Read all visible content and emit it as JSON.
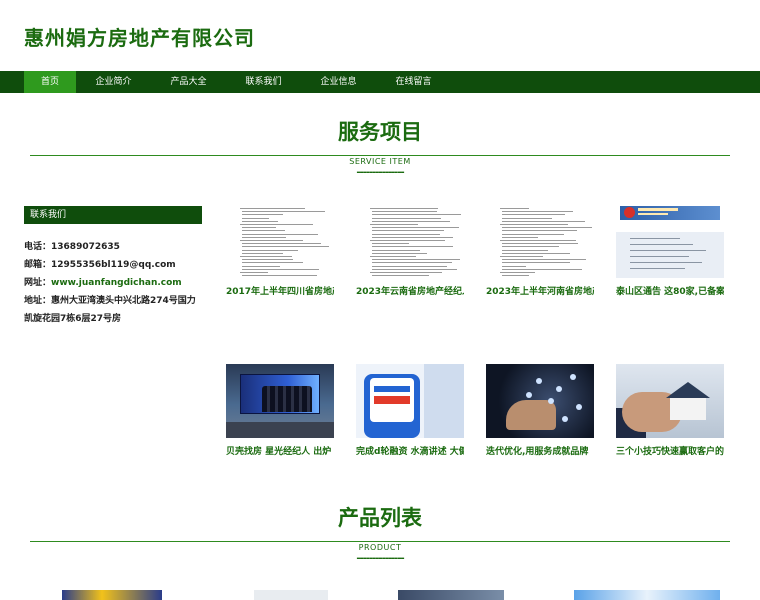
{
  "site": {
    "title": "惠州娟方房地产有限公司"
  },
  "nav": {
    "items": [
      {
        "label": "首页"
      },
      {
        "label": "企业简介"
      },
      {
        "label": "产品大全"
      },
      {
        "label": "联系我们"
      },
      {
        "label": "企业信息"
      },
      {
        "label": "在线留言"
      }
    ]
  },
  "services": {
    "title": "服务项目",
    "subtitle": "SERVICE ITEM",
    "dashes": "---------------"
  },
  "contact": {
    "heading": "联系我们",
    "phone_label": "电话：",
    "phone": "13689072635",
    "email_label": "邮箱：",
    "email": "12955356bl119@qq.com",
    "site_label": "网址：",
    "site": "www.juanfangdichan.com",
    "address_label": "地址：",
    "address": "惠州大亚湾澳头中兴北路274号国力凯旋花园7栋6层27号房"
  },
  "cards": [
    {
      "caption": "2017年上半年四川省房地产"
    },
    {
      "caption": "2023年云南省房地产经纪人"
    },
    {
      "caption": "2023年上半年河南省房地产"
    },
    {
      "caption": "泰山区通告 这80家,已备案"
    },
    {
      "caption": "贝壳找房 星光经纪人 出炉 诠"
    },
    {
      "caption": "完成d轮融资 水滴讲述 大健"
    },
    {
      "caption": "迭代优化,用服务成就品牌"
    },
    {
      "caption": "三个小技巧快速赢取客户的"
    }
  ],
  "products": {
    "title": "产品列表",
    "subtitle": "PRODUCT",
    "dashes": "---------------"
  },
  "colors": {
    "brand_green": "#1b6b10",
    "nav_dark": "#0f4d0c",
    "nav_active": "#2f9a1e"
  }
}
